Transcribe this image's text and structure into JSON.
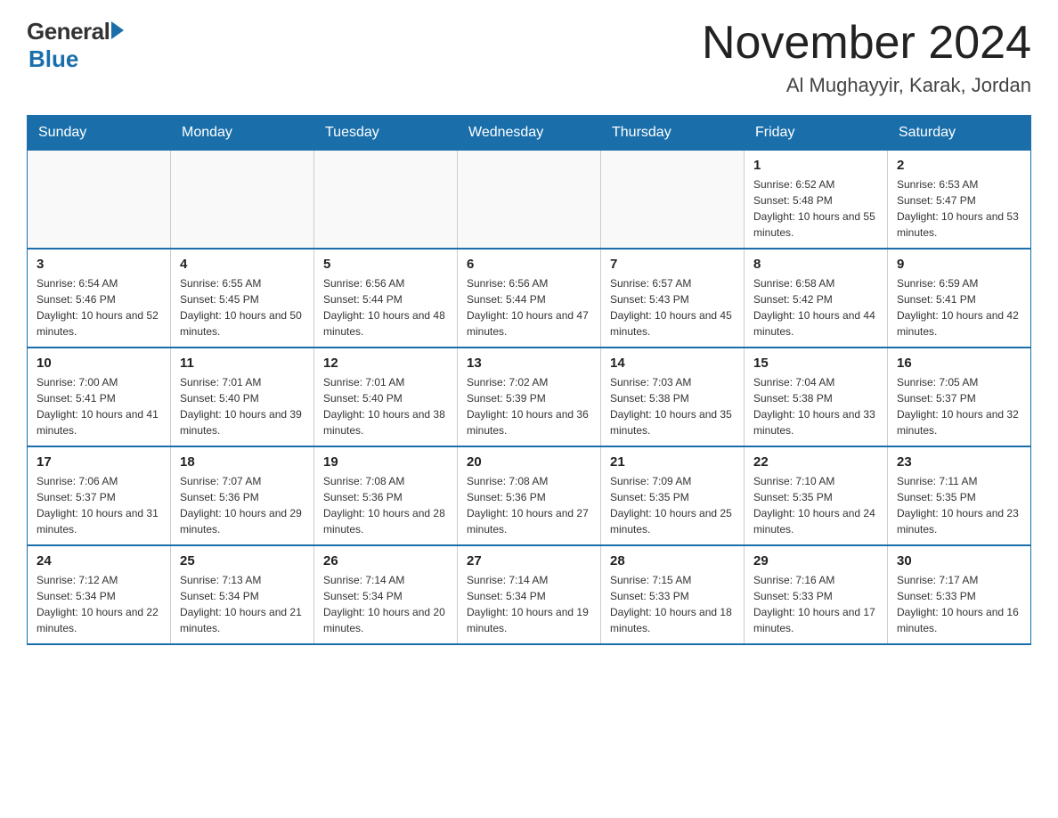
{
  "header": {
    "logo_general": "General",
    "logo_blue": "Blue",
    "month_title": "November 2024",
    "location": "Al Mughayyir, Karak, Jordan"
  },
  "days_of_week": [
    "Sunday",
    "Monday",
    "Tuesday",
    "Wednesday",
    "Thursday",
    "Friday",
    "Saturday"
  ],
  "weeks": [
    [
      {
        "day": "",
        "info": ""
      },
      {
        "day": "",
        "info": ""
      },
      {
        "day": "",
        "info": ""
      },
      {
        "day": "",
        "info": ""
      },
      {
        "day": "",
        "info": ""
      },
      {
        "day": "1",
        "info": "Sunrise: 6:52 AM\nSunset: 5:48 PM\nDaylight: 10 hours and 55 minutes."
      },
      {
        "day": "2",
        "info": "Sunrise: 6:53 AM\nSunset: 5:47 PM\nDaylight: 10 hours and 53 minutes."
      }
    ],
    [
      {
        "day": "3",
        "info": "Sunrise: 6:54 AM\nSunset: 5:46 PM\nDaylight: 10 hours and 52 minutes."
      },
      {
        "day": "4",
        "info": "Sunrise: 6:55 AM\nSunset: 5:45 PM\nDaylight: 10 hours and 50 minutes."
      },
      {
        "day": "5",
        "info": "Sunrise: 6:56 AM\nSunset: 5:44 PM\nDaylight: 10 hours and 48 minutes."
      },
      {
        "day": "6",
        "info": "Sunrise: 6:56 AM\nSunset: 5:44 PM\nDaylight: 10 hours and 47 minutes."
      },
      {
        "day": "7",
        "info": "Sunrise: 6:57 AM\nSunset: 5:43 PM\nDaylight: 10 hours and 45 minutes."
      },
      {
        "day": "8",
        "info": "Sunrise: 6:58 AM\nSunset: 5:42 PM\nDaylight: 10 hours and 44 minutes."
      },
      {
        "day": "9",
        "info": "Sunrise: 6:59 AM\nSunset: 5:41 PM\nDaylight: 10 hours and 42 minutes."
      }
    ],
    [
      {
        "day": "10",
        "info": "Sunrise: 7:00 AM\nSunset: 5:41 PM\nDaylight: 10 hours and 41 minutes."
      },
      {
        "day": "11",
        "info": "Sunrise: 7:01 AM\nSunset: 5:40 PM\nDaylight: 10 hours and 39 minutes."
      },
      {
        "day": "12",
        "info": "Sunrise: 7:01 AM\nSunset: 5:40 PM\nDaylight: 10 hours and 38 minutes."
      },
      {
        "day": "13",
        "info": "Sunrise: 7:02 AM\nSunset: 5:39 PM\nDaylight: 10 hours and 36 minutes."
      },
      {
        "day": "14",
        "info": "Sunrise: 7:03 AM\nSunset: 5:38 PM\nDaylight: 10 hours and 35 minutes."
      },
      {
        "day": "15",
        "info": "Sunrise: 7:04 AM\nSunset: 5:38 PM\nDaylight: 10 hours and 33 minutes."
      },
      {
        "day": "16",
        "info": "Sunrise: 7:05 AM\nSunset: 5:37 PM\nDaylight: 10 hours and 32 minutes."
      }
    ],
    [
      {
        "day": "17",
        "info": "Sunrise: 7:06 AM\nSunset: 5:37 PM\nDaylight: 10 hours and 31 minutes."
      },
      {
        "day": "18",
        "info": "Sunrise: 7:07 AM\nSunset: 5:36 PM\nDaylight: 10 hours and 29 minutes."
      },
      {
        "day": "19",
        "info": "Sunrise: 7:08 AM\nSunset: 5:36 PM\nDaylight: 10 hours and 28 minutes."
      },
      {
        "day": "20",
        "info": "Sunrise: 7:08 AM\nSunset: 5:36 PM\nDaylight: 10 hours and 27 minutes."
      },
      {
        "day": "21",
        "info": "Sunrise: 7:09 AM\nSunset: 5:35 PM\nDaylight: 10 hours and 25 minutes."
      },
      {
        "day": "22",
        "info": "Sunrise: 7:10 AM\nSunset: 5:35 PM\nDaylight: 10 hours and 24 minutes."
      },
      {
        "day": "23",
        "info": "Sunrise: 7:11 AM\nSunset: 5:35 PM\nDaylight: 10 hours and 23 minutes."
      }
    ],
    [
      {
        "day": "24",
        "info": "Sunrise: 7:12 AM\nSunset: 5:34 PM\nDaylight: 10 hours and 22 minutes."
      },
      {
        "day": "25",
        "info": "Sunrise: 7:13 AM\nSunset: 5:34 PM\nDaylight: 10 hours and 21 minutes."
      },
      {
        "day": "26",
        "info": "Sunrise: 7:14 AM\nSunset: 5:34 PM\nDaylight: 10 hours and 20 minutes."
      },
      {
        "day": "27",
        "info": "Sunrise: 7:14 AM\nSunset: 5:34 PM\nDaylight: 10 hours and 19 minutes."
      },
      {
        "day": "28",
        "info": "Sunrise: 7:15 AM\nSunset: 5:33 PM\nDaylight: 10 hours and 18 minutes."
      },
      {
        "day": "29",
        "info": "Sunrise: 7:16 AM\nSunset: 5:33 PM\nDaylight: 10 hours and 17 minutes."
      },
      {
        "day": "30",
        "info": "Sunrise: 7:17 AM\nSunset: 5:33 PM\nDaylight: 10 hours and 16 minutes."
      }
    ]
  ]
}
